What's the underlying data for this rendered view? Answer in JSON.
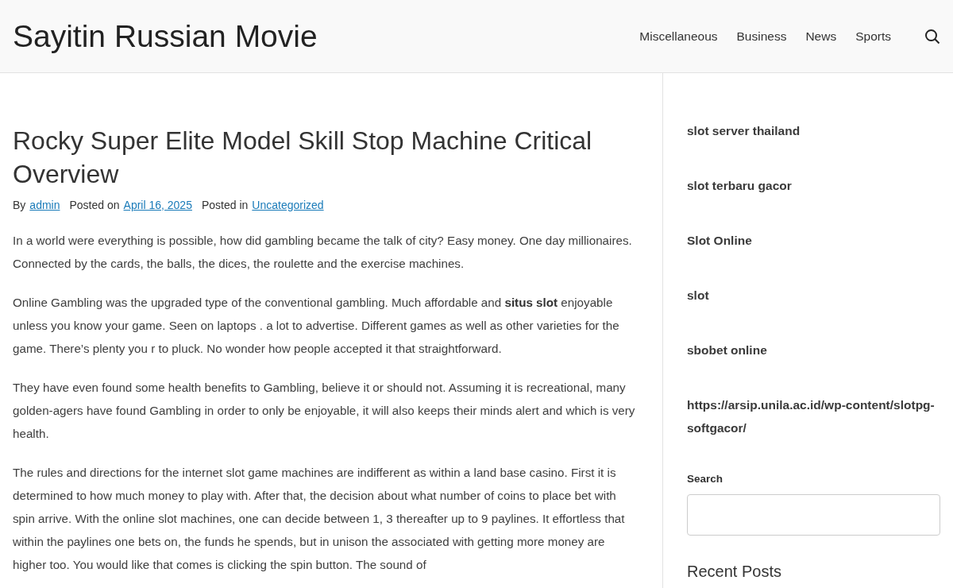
{
  "site_title": "Sayitin Russian Movie",
  "nav": [
    {
      "label": "Miscellaneous"
    },
    {
      "label": "Business"
    },
    {
      "label": "News"
    },
    {
      "label": "Sports"
    }
  ],
  "article": {
    "title": "Rocky Super Elite Model Skill Stop Machine Critical Overview",
    "meta": [
      {
        "prefix": "By",
        "link": "admin"
      },
      {
        "prefix": "Posted on",
        "link": "April 16, 2025"
      },
      {
        "prefix": "Posted in",
        "link": "Uncategorized"
      }
    ],
    "paragraphs": [
      "In a world were everything is possible, how did gambling became the talk of city? Easy money. One day millionaires. Connected by the cards, the balls, the dices, the roulette and the exercise machines.",
      "Online Gambling was the upgraded type of the conventional gambling. Much affordable and **situs slot** enjoyable unless you know your game. Seen on laptops . a lot to advertise. Different games as well as other varieties for the game. There’s plenty you r to pluck. No wonder how people accepted it that straightforward.",
      "They have even found some health benefits to Gambling, believe it or should not. Assuming it is recreational, many golden-agers have found Gambling in order to only be enjoyable, it will also keeps their minds alert and which is very health.",
      "The rules and directions for the internet slot game machines are indifferent as within a land base casino. First it is determined to how much money to play with. After that, the decision about what number of coins to place bet with spin arrive. With the online slot machines, one can decide between 1, 3 thereafter up to 9 paylines. It effortless that within the paylines one bets on, the funds he spends, but in unison the associated with getting more money are higher too. You would like that comes is clicking the spin button. The sound of"
    ]
  },
  "sidebar": {
    "links": [
      "slot server thailand",
      "slot terbaru gacor",
      "Slot Online",
      "slot",
      "sbobet online",
      "https://arsip.unila.ac.id/wp-content/slotpg-softgacor/"
    ],
    "search_label": "Search",
    "recent_heading": "Recent Posts"
  }
}
